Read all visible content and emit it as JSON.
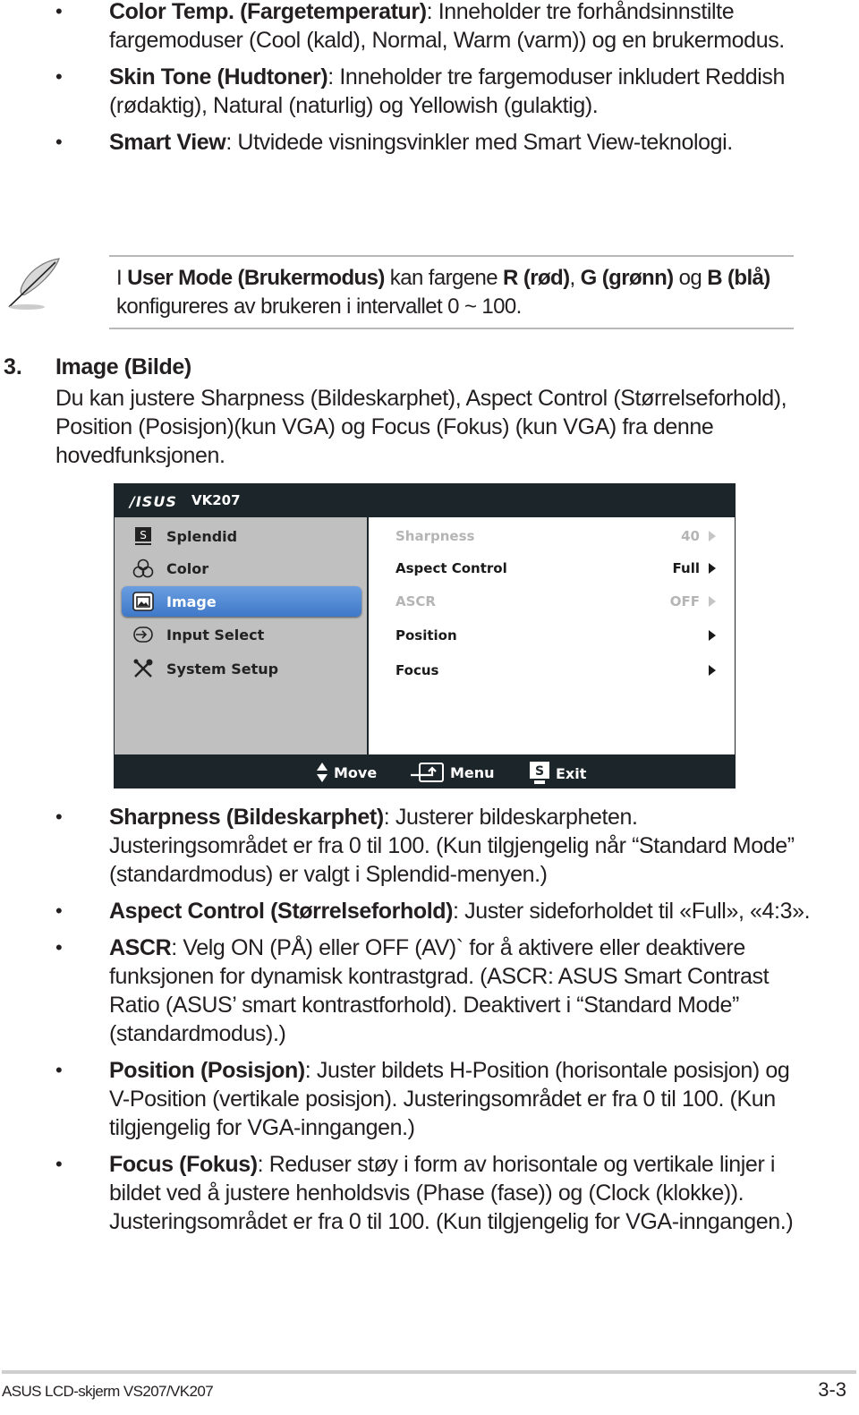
{
  "top_bullets": [
    {
      "term": "Color Temp. (Fargetemperatur)",
      "text": ": Inneholder tre forhåndsinnstilte fargemoduser (Cool (kald), Normal, Warm (varm)) og en brukermodus."
    },
    {
      "term": "Skin Tone (Hudtoner)",
      "text": ": Inneholder tre fargemoduser inkludert Reddish (rødaktig), Natural (naturlig) og Yellowish (gulaktig)."
    },
    {
      "term": "Smart View",
      "text": ": Utvidede visningsvinkler med Smart View-teknologi."
    }
  ],
  "note": {
    "icon": "feather-icon",
    "parts": {
      "p1": "I ",
      "b1": "User Mode (Brukermodus)",
      "p2": " kan fargene ",
      "b2": "R (rød)",
      "p3": ", ",
      "b3": "G (grønn)",
      "p4": " og ",
      "b4": "B (blå)",
      "p5": " konfigureres av brukeren i intervallet 0 ~ 100."
    }
  },
  "section": {
    "number": "3.",
    "title": "Image (Bilde)",
    "description": "Du kan justere Sharpness (Bildeskarphet), Aspect Control (Størrelseforhold), Position (Posisjon)(kun VGA) og Focus (Fokus) (kun VGA) fra denne hovedfunksjonen."
  },
  "osd": {
    "brand": "/ISUS",
    "model": "VK207",
    "menu": [
      {
        "label": "Splendid",
        "icon": "splendid-icon",
        "active": false
      },
      {
        "label": "Color",
        "icon": "rgb-color-icon",
        "active": false
      },
      {
        "label": "Image",
        "icon": "image-icon",
        "active": true
      },
      {
        "label": "Input Select",
        "icon": "input-select-icon",
        "active": false
      },
      {
        "label": "System Setup",
        "icon": "wrench-screwdriver-icon",
        "active": false
      }
    ],
    "submenu": [
      {
        "label": "Sharpness",
        "value": "40",
        "disabled": true
      },
      {
        "label": "Aspect Control",
        "value": "Full",
        "disabled": false
      },
      {
        "label": "ASCR",
        "value": "OFF",
        "disabled": true
      },
      {
        "label": "Position",
        "value": "",
        "disabled": false
      },
      {
        "label": "Focus",
        "value": "",
        "disabled": false
      }
    ],
    "footer": {
      "move": "Move",
      "menu": "Menu",
      "exit": "Exit",
      "exit_key": "S"
    },
    "colors": {
      "active": "#4a86d0",
      "bar": "#1c2529"
    }
  },
  "bottom_bullets": [
    {
      "term": "Sharpness (Bildeskarphet)",
      "text": ": Justerer bildeskarpheten. Justeringsområdet er fra 0 til 100. (Kun tilgjengelig når “Standard Mode” (standardmodus) er valgt i Splendid-menyen.)"
    },
    {
      "term": "Aspect Control (Størrelseforhold)",
      "text": ": Juster sideforholdet til «Full», «4:3»."
    },
    {
      "term": "ASCR",
      "text": ": Velg ON (PÅ) eller OFF (AV)` for å aktivere eller deaktivere funksjonen for dynamisk kontrastgrad. (ASCR: ASUS Smart Contrast Ratio (ASUS’ smart kontrastforhold). Deaktivert i “Standard Mode” (standardmodus).)"
    },
    {
      "term": "Position (Posisjon)",
      "text": ": Juster bildets H-Position (horisontale posisjon) og V-Position (vertikale posisjon). Justeringsområdet er fra 0 til 100. (Kun tilgjengelig for VGA-inngangen.)"
    },
    {
      "term": "Focus (Fokus)",
      "text": ": Reduser støy i form av horisontale og vertikale linjer i bildet ved å justere henholdsvis (Phase (fase)) og (Clock (klokke)). Justeringsområdet er fra 0 til 100. (Kun tilgjengelig for VGA-inngangen.)"
    }
  ],
  "footer": {
    "left": "ASUS LCD-skjerm VS207/VK207",
    "page": "3-3"
  }
}
